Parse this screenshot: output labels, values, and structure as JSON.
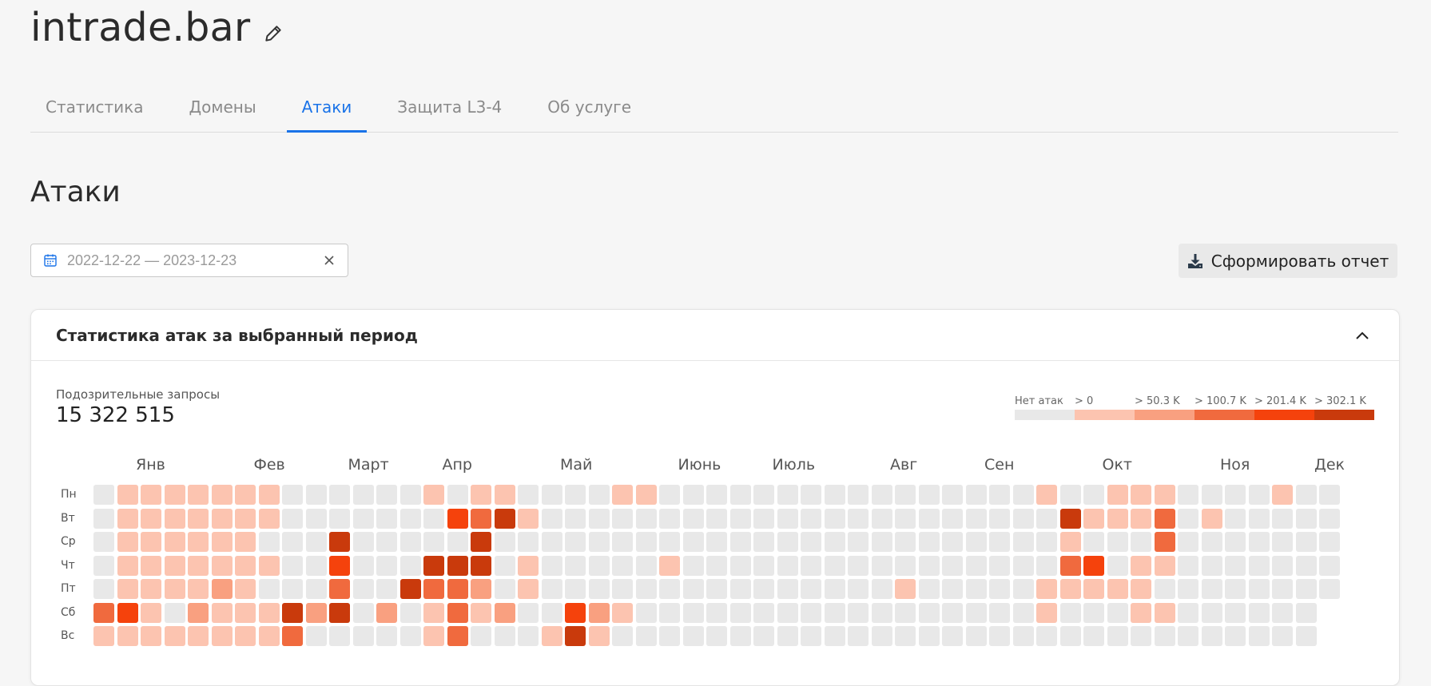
{
  "site": {
    "title": "intrade.bar"
  },
  "tabs": [
    {
      "label": "Статистика",
      "active": false
    },
    {
      "label": "Домены",
      "active": false
    },
    {
      "label": "Атаки",
      "active": true
    },
    {
      "label": "Защита L3-4",
      "active": false
    },
    {
      "label": "Об услуге",
      "active": false
    }
  ],
  "page": {
    "title": "Атаки"
  },
  "date_range": {
    "value": "2022-12-22 — 2023-12-23"
  },
  "report_button": {
    "label": "Сформировать отчет"
  },
  "card": {
    "title": "Статистика атак за выбранный период",
    "stat_label": "Подозрительные запросы",
    "stat_value": "15 322 515"
  },
  "legend": [
    {
      "label": "Нет атак",
      "color": "#e8e8e8"
    },
    {
      "label": "> 0",
      "color": "#fcc4b0"
    },
    {
      "label": "> 50.3 K",
      "color": "#f9a080"
    },
    {
      "label": "> 100.7 K",
      "color": "#f06a3e"
    },
    {
      "label": "> 201.4 K",
      "color": "#f5420c"
    },
    {
      "label": "> 302.1 K",
      "color": "#c93a0c"
    }
  ],
  "heatmap": {
    "months": [
      "Янв",
      "Фев",
      "Март",
      "Апр",
      "Май",
      "Июнь",
      "Июль",
      "Авг",
      "Сен",
      "Окт",
      "Ноя",
      "Дек"
    ],
    "month_weeks": [
      3,
      8,
      12,
      16,
      21,
      26,
      30,
      35,
      39,
      44,
      49,
      53
    ],
    "days": [
      "Пн",
      "Вт",
      "Ср",
      "Чт",
      "Пт",
      "Сб",
      "Вс"
    ],
    "levels": [
      [
        0,
        1,
        1,
        1,
        1,
        1,
        1,
        1,
        0,
        0,
        0,
        0,
        0,
        0,
        1,
        0,
        1,
        1,
        0,
        0,
        0,
        0,
        1,
        1,
        0,
        0,
        0,
        0,
        0,
        0,
        0,
        0,
        0,
        0,
        0,
        0,
        0,
        0,
        0,
        0,
        1,
        0,
        0,
        1,
        1,
        1,
        0,
        0,
        0,
        0,
        1,
        0,
        0
      ],
      [
        0,
        1,
        1,
        1,
        1,
        1,
        1,
        1,
        0,
        0,
        0,
        0,
        0,
        0,
        0,
        4,
        3,
        5,
        1,
        0,
        0,
        0,
        0,
        0,
        0,
        0,
        0,
        0,
        0,
        0,
        0,
        0,
        0,
        0,
        0,
        0,
        0,
        0,
        0,
        0,
        0,
        5,
        1,
        1,
        1,
        3,
        0,
        1,
        0,
        0,
        0,
        0,
        0
      ],
      [
        0,
        1,
        1,
        1,
        1,
        1,
        1,
        0,
        0,
        0,
        5,
        0,
        0,
        0,
        0,
        0,
        5,
        0,
        0,
        0,
        0,
        0,
        0,
        0,
        0,
        0,
        0,
        0,
        0,
        0,
        0,
        0,
        0,
        0,
        0,
        0,
        0,
        0,
        0,
        0,
        0,
        1,
        0,
        0,
        0,
        3,
        0,
        0,
        0,
        0,
        0,
        0,
        0
      ],
      [
        0,
        1,
        1,
        1,
        1,
        1,
        1,
        1,
        0,
        0,
        4,
        0,
        0,
        0,
        5,
        5,
        5,
        0,
        1,
        0,
        0,
        0,
        0,
        0,
        1,
        0,
        0,
        0,
        0,
        0,
        0,
        0,
        0,
        0,
        0,
        0,
        0,
        0,
        0,
        0,
        0,
        3,
        4,
        0,
        1,
        1,
        0,
        0,
        0,
        0,
        0,
        0,
        0
      ],
      [
        0,
        1,
        1,
        1,
        1,
        2,
        1,
        0,
        0,
        0,
        3,
        0,
        0,
        5,
        3,
        3,
        2,
        0,
        1,
        0,
        0,
        0,
        0,
        0,
        0,
        0,
        0,
        0,
        0,
        0,
        0,
        0,
        0,
        0,
        1,
        0,
        0,
        0,
        0,
        0,
        1,
        1,
        1,
        1,
        1,
        0,
        0,
        0,
        0,
        0,
        0,
        0,
        0
      ],
      [
        3,
        4,
        1,
        0,
        2,
        1,
        1,
        1,
        5,
        2,
        5,
        0,
        2,
        0,
        1,
        3,
        1,
        2,
        0,
        0,
        4,
        2,
        1,
        0,
        0,
        0,
        0,
        0,
        0,
        0,
        0,
        0,
        0,
        0,
        0,
        0,
        0,
        0,
        0,
        0,
        1,
        0,
        0,
        0,
        1,
        1,
        0,
        0,
        0,
        0,
        0,
        0,
        -1
      ],
      [
        1,
        1,
        1,
        1,
        1,
        1,
        1,
        1,
        3,
        0,
        0,
        0,
        0,
        0,
        1,
        3,
        0,
        0,
        0,
        1,
        5,
        1,
        0,
        0,
        0,
        0,
        0,
        0,
        0,
        0,
        0,
        0,
        0,
        0,
        0,
        0,
        0,
        0,
        0,
        0,
        0,
        0,
        0,
        0,
        0,
        0,
        0,
        0,
        0,
        0,
        0,
        0,
        -1
      ]
    ]
  }
}
